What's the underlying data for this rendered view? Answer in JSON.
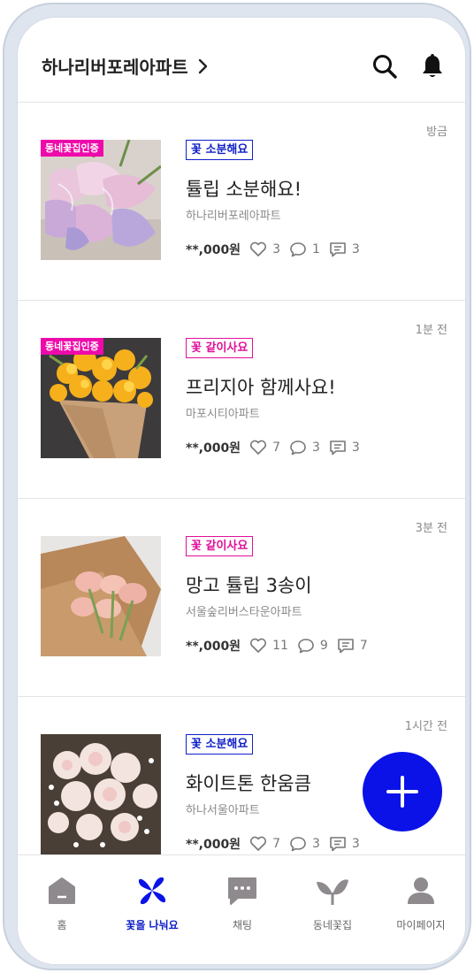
{
  "header": {
    "title": "하나리버포레아파트",
    "search_icon": "search-icon",
    "bell_icon": "bell-icon"
  },
  "cert_badge": "동네꽃집인증",
  "posts": [
    {
      "time": "방금",
      "certified": true,
      "tag": "꽃 소분해요",
      "tag_type": "share",
      "title": "튤립 소분해요!",
      "place": "하나리버포레아파트",
      "price": "**,000원",
      "likes": "3",
      "comments": "1",
      "chats": "3"
    },
    {
      "time": "1분 전",
      "certified": true,
      "tag": "꽃 같이사요",
      "tag_type": "buy",
      "title": "프리지아 함께사요!",
      "place": "마포시티아파트",
      "price": "**,000원",
      "likes": "7",
      "comments": "3",
      "chats": "3"
    },
    {
      "time": "3분 전",
      "certified": false,
      "tag": "꽃 같이사요",
      "tag_type": "buy",
      "title": "망고 튤립 3송이",
      "place": "서울숲리버스타운아파트",
      "price": "**,000원",
      "likes": "11",
      "comments": "9",
      "chats": "7"
    },
    {
      "time": "1시간 전",
      "certified": false,
      "tag": "꽃 소분해요",
      "tag_type": "share",
      "title": "화이트톤 한움큼",
      "place": "하나서울아파트",
      "price": "**,000원",
      "likes": "7",
      "comments": "3",
      "chats": "3"
    }
  ],
  "nav": [
    {
      "label": "홈",
      "icon": "home-icon",
      "active": false
    },
    {
      "label": "꽃을 나눠요",
      "icon": "flower-icon",
      "active": true
    },
    {
      "label": "채팅",
      "icon": "chat-icon",
      "active": false
    },
    {
      "label": "동네꽃집",
      "icon": "sprout-icon",
      "active": false
    },
    {
      "label": "마이페이지",
      "icon": "person-icon",
      "active": false
    }
  ],
  "colors": {
    "accent_blue": "#0a12e8",
    "accent_pink": "#ee0aaa",
    "share_tag": "#1020c8",
    "buy_tag": "#e0109a"
  }
}
